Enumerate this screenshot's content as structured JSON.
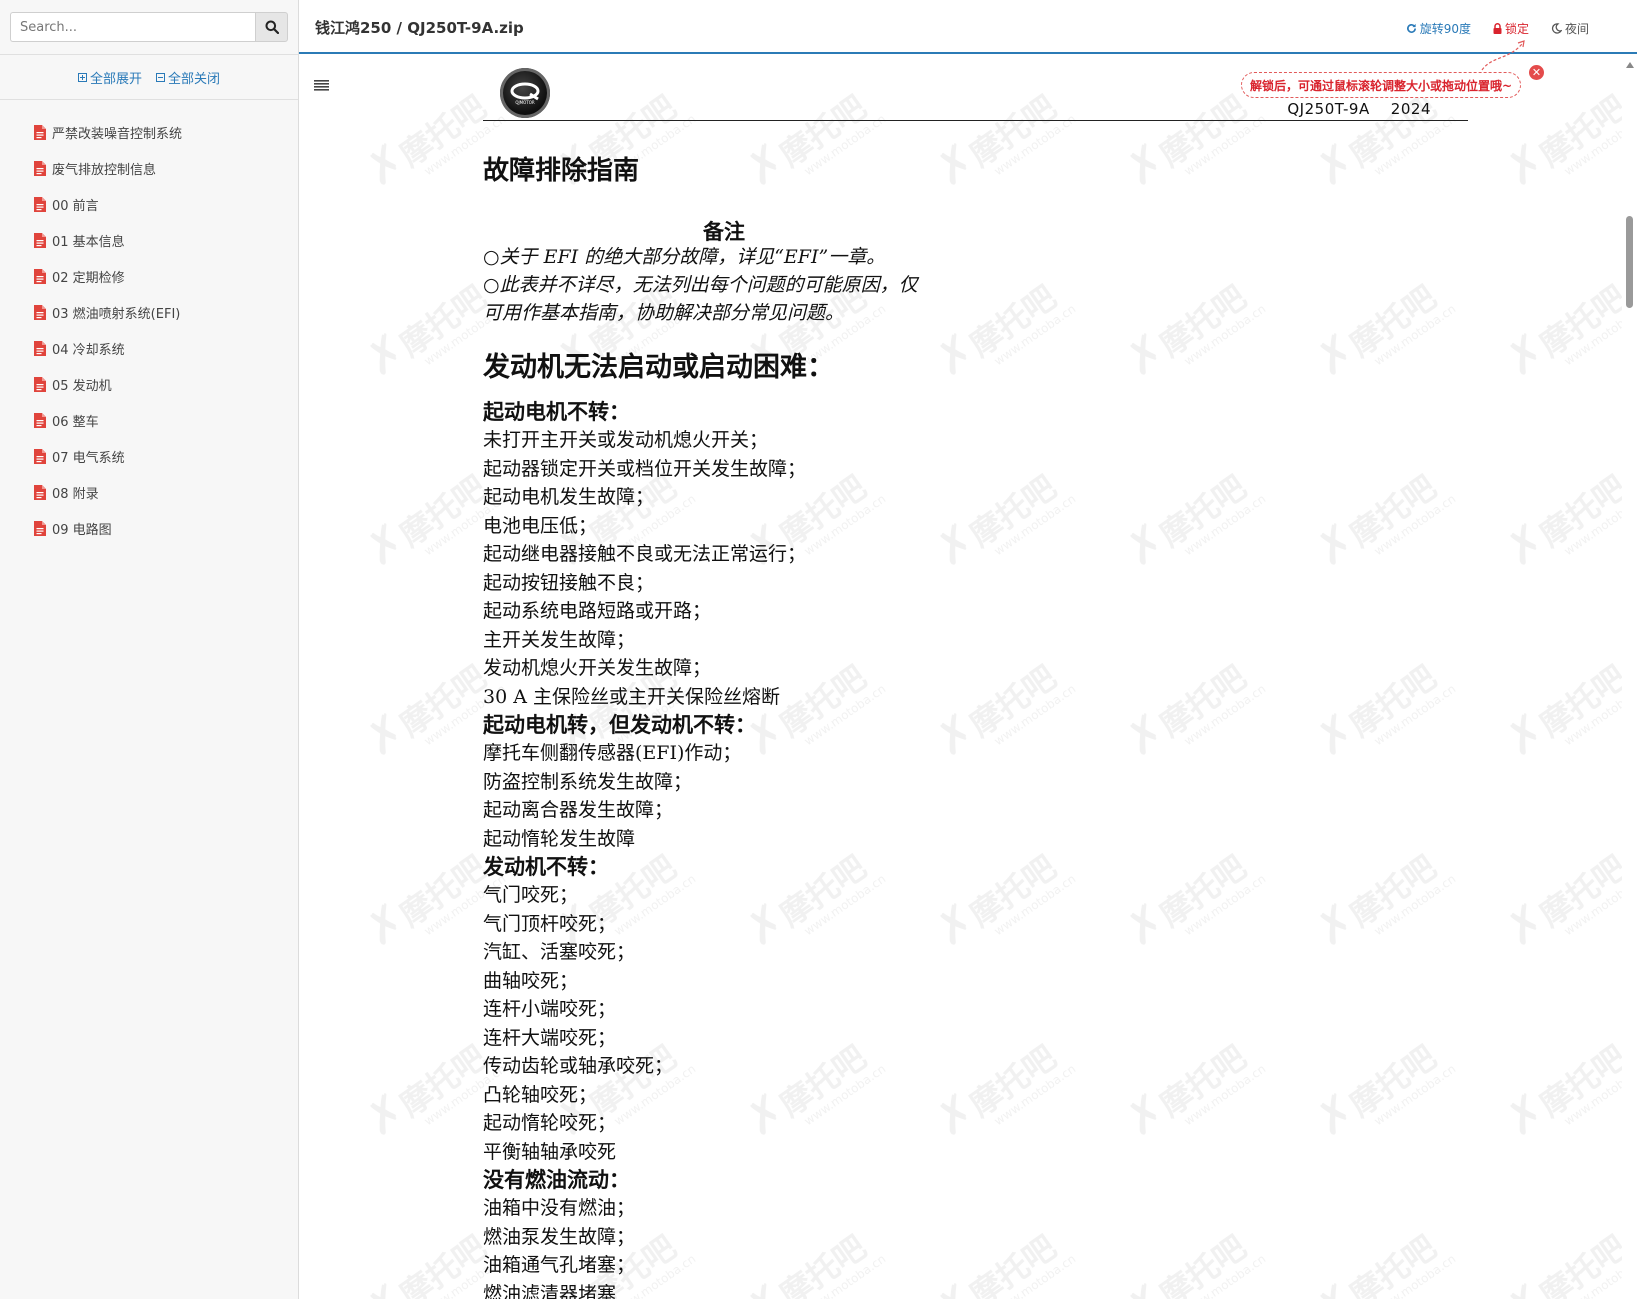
{
  "sidebar": {
    "search_placeholder": "Search...",
    "expand_all": "全部展开",
    "collapse_all": "全部关闭",
    "items": [
      "严禁改装噪音控制系统",
      "废气排放控制信息",
      "00 前言",
      "01 基本信息",
      "02 定期检修",
      "03 燃油喷射系统(EFI)",
      "04 冷却系统",
      "05 发动机",
      "06 整车",
      "07 电气系统",
      "08 附录",
      "09 电路图"
    ]
  },
  "header": {
    "title": "钱江鸿250 / QJ250T-9A.zip",
    "rotate": "旋转90度",
    "lock": "锁定",
    "night": "夜间"
  },
  "hint": {
    "text": "解锁后，可通过鼠标滚轮调整大小或拖动位置哦~"
  },
  "watermark": {
    "brand": "摩托吧",
    "url": "www.motoba.cn"
  },
  "document": {
    "logo_text": "QJMOTOR",
    "model": "QJ250T-9A    2024",
    "heading": "故障排除指南",
    "note_title": "备注",
    "note_lines": [
      "○关于 EFI 的绝大部分故障，详见“EFI”一章。",
      "○此表并不详尽，无法列出每个问题的可能原因，仅",
      "可用作基本指南，协助解决部分常见问题。"
    ],
    "section_heading": "发动机无法启动或启动困难：",
    "sections": [
      {
        "title": "起动电机不转：",
        "lines": [
          "未打开主开关或发动机熄火开关；",
          "起动器锁定开关或档位开关发生故障；",
          "起动电机发生故障；",
          "电池电压低；",
          "起动继电器接触不良或无法正常运行；",
          "起动按钮接触不良；",
          "起动系统电路短路或开路；",
          "主开关发生故障；",
          "发动机熄火开关发生故障；",
          "30 A 主保险丝或主开关保险丝熔断"
        ]
      },
      {
        "title": "起动电机转，但发动机不转：",
        "lines": [
          "摩托车侧翻传感器(EFI)作动；",
          "防盗控制系统发生故障；",
          "起动离合器发生故障；",
          "起动惰轮发生故障"
        ]
      },
      {
        "title": "发动机不转：",
        "lines": [
          "气门咬死；",
          "气门顶杆咬死；",
          "汽缸、活塞咬死；",
          "曲轴咬死；",
          "连杆小端咬死；",
          "连杆大端咬死；",
          "传动齿轮或轴承咬死；",
          "凸轮轴咬死；",
          "起动惰轮咬死；",
          "平衡轴轴承咬死"
        ]
      },
      {
        "title": "没有燃油流动：",
        "lines": [
          "油箱中没有燃油；",
          "燃油泵发生故障；",
          "油箱通气孔堵塞；",
          "燃油滤清器堵塞"
        ]
      }
    ]
  },
  "colors": {
    "accent": "#2b7bb6",
    "danger": "#d9232d",
    "pdf_icon": "#e0443c"
  }
}
